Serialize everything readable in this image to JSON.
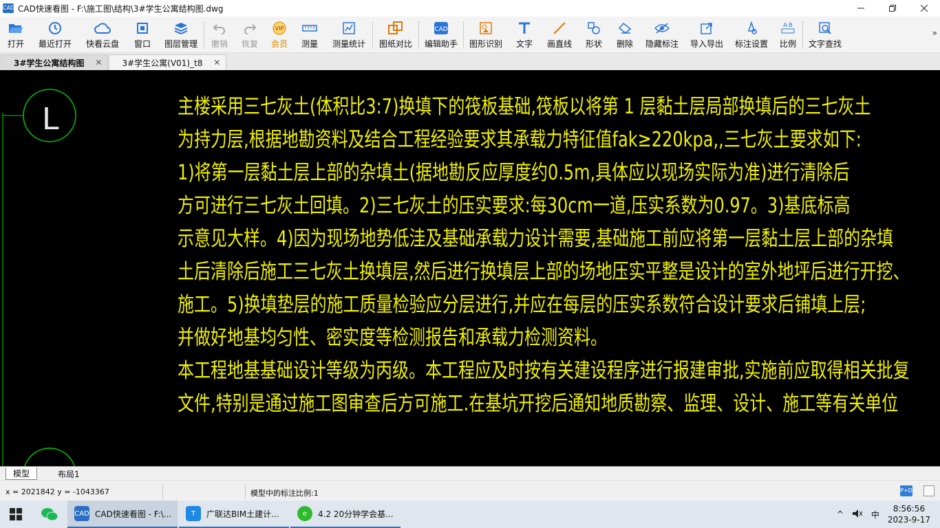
{
  "window": {
    "app_icon": "CAD",
    "title": "CAD快速看图 - F:\\施工图\\结构\\3#学生公寓结构图.dwg",
    "controls": [
      "minimize-icon",
      "restore-icon",
      "close-icon"
    ]
  },
  "toolbar": {
    "items": [
      {
        "label": "打开",
        "icon": "folder-open-icon"
      },
      {
        "label": "最近打开",
        "icon": "recent-icon"
      },
      {
        "label": "快看云盘",
        "icon": "cloud-icon"
      },
      {
        "label": "窗口",
        "icon": "window-icon"
      },
      {
        "label": "图层管理",
        "icon": "layers-icon"
      },
      {
        "label": "撤销",
        "icon": "undo-icon",
        "disabled": true
      },
      {
        "label": "恢复",
        "icon": "redo-icon",
        "disabled": true
      },
      {
        "label": "会员",
        "icon": "vip-icon"
      },
      {
        "label": "测量",
        "icon": "measure-icon"
      },
      {
        "label": "测量统计",
        "icon": "measure-stats-icon"
      },
      {
        "label": "图纸对比",
        "icon": "compare-icon"
      },
      {
        "label": "编辑助手",
        "icon": "edit-assistant-icon"
      },
      {
        "label": "图形识别",
        "icon": "shape-recognize-icon"
      },
      {
        "label": "文字",
        "icon": "text-icon"
      },
      {
        "label": "画直线",
        "icon": "line-icon"
      },
      {
        "label": "形状",
        "icon": "shape-icon"
      },
      {
        "label": "删除",
        "icon": "eraser-icon"
      },
      {
        "label": "隐藏标注",
        "icon": "hide-annotation-icon"
      },
      {
        "label": "导入导出",
        "icon": "import-export-icon"
      },
      {
        "label": "标注设置",
        "icon": "annotation-settings-icon"
      },
      {
        "label": "比例",
        "icon": "scale-icon"
      },
      {
        "label": "文字查找",
        "icon": "text-search-icon"
      }
    ],
    "more": "»"
  },
  "tabs": [
    {
      "label": "3#学生公寓结构图",
      "close": "✕",
      "active": true
    },
    {
      "label": "3#学生公寓(V01)_t8",
      "close": "✕",
      "active": false
    }
  ],
  "canvas": {
    "axis_label": "L",
    "lines": [
      "主楼采用三七灰土(体积比3:7)换填下的筏板基础,筏板以将第 1 层黏土层局部换填后的三七灰土",
      "为持力层,根据地勘资料及结合工程经验要求其承载力特征值fak≥220kpa,,三七灰土要求如下:",
      "1)将第一层黏土层上部的杂填土(据地勘反应厚度约0.5m,具体应以现场实际为准)进行清除后",
      "方可进行三七灰土回填。2)三七灰土的压实要求:每30cm一道,压实系数为0.97。3)基底标高",
      "示意见大样。4)因为现场地势低洼及基础承载力设计需要,基础施工前应将第一层黏土层上部的杂填",
      "土后清除后施工三七灰土换填层,然后进行换填层上部的场地压实平整是设计的室外地坪后进行开挖、",
      "施工。5)换填垫层的施工质量检验应分层进行,并应在每层的压实系数符合设计要求后铺填上层;",
      "并做好地基均匀性、密实度等检测报告和承载力检测资料。",
      "本工程地基基础设计等级为丙级。本工程应及时按有关建设程序进行报建审批,实施前应取得相关批复",
      "文件,特别是通过施工图审查后方可施工.在基坑开挖后通知地质勘察、监理、设计、施工等有关单位"
    ],
    "text_color": "#f0f000",
    "circle_color": "#00d000"
  },
  "layout_tabs": [
    {
      "label": "模型",
      "active": true
    },
    {
      "label": "布局1",
      "active": false
    }
  ],
  "status": {
    "coords": "x = 2021842  y = -1043367",
    "scale": "模型中的标注比例:1",
    "badge": "P+D"
  },
  "taskbar": {
    "items": [
      {
        "label": "CAD快速看图 - F:\\...",
        "active": true,
        "icon_text": "CAD",
        "icon_color": "#2b6fc5"
      },
      {
        "label": "广联达BIM土建计...",
        "active": false,
        "icon_text": "T",
        "icon_color": "#1e88e5"
      },
      {
        "label": "4.2 20分钟学会基...",
        "active": false,
        "icon_text": "e",
        "icon_color": "#2eb82e"
      }
    ],
    "tray": {
      "chevron": "^",
      "ime": "中",
      "time": "8:56:56",
      "date": "2023-9-17"
    }
  }
}
